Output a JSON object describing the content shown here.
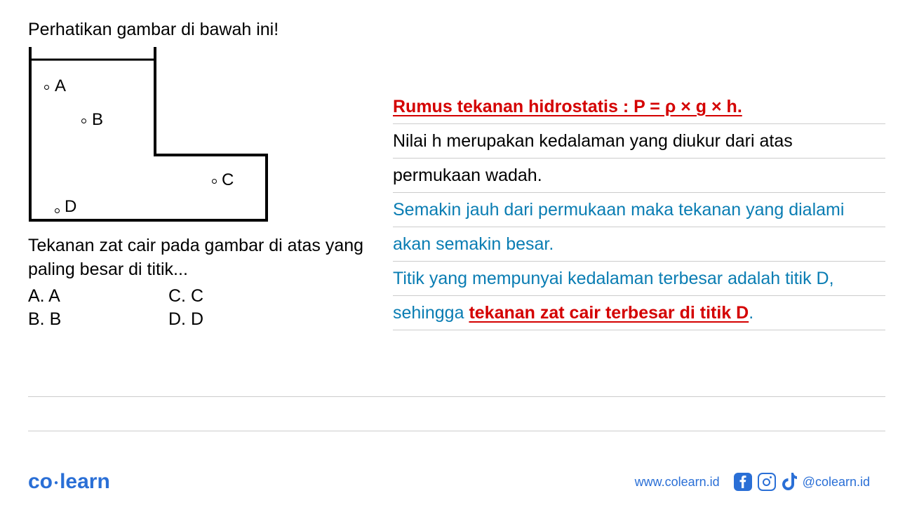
{
  "instruction": "Perhatikan gambar di bawah ini!",
  "diagram_points": {
    "A": "A",
    "B": "B",
    "C": "C",
    "D": "D"
  },
  "question": "Tekanan zat cair pada gambar di atas yang paling besar di titik...",
  "options": {
    "A": "A.  A",
    "B": "B.  B",
    "C": "C.  C",
    "D": "D.  D"
  },
  "explanation": {
    "line1": "Rumus tekanan hidrostatis : P = ρ × g × h.",
    "line2": "Nilai h merupakan kedalaman yang diukur dari atas",
    "line3": "permukaan wadah.",
    "line4": "Semakin jauh dari permukaan maka tekanan yang dialami",
    "line5": "akan semakin besar.",
    "line6": "Titik yang mempunyai kedalaman terbesar adalah titik D,",
    "line7a": "sehingga ",
    "line7b": "tekanan zat cair terbesar di titik D",
    "line7c": "."
  },
  "footer": {
    "logo1": "co",
    "logo2": "learn",
    "url": "www.colearn.id",
    "handle": "@colearn.id"
  }
}
